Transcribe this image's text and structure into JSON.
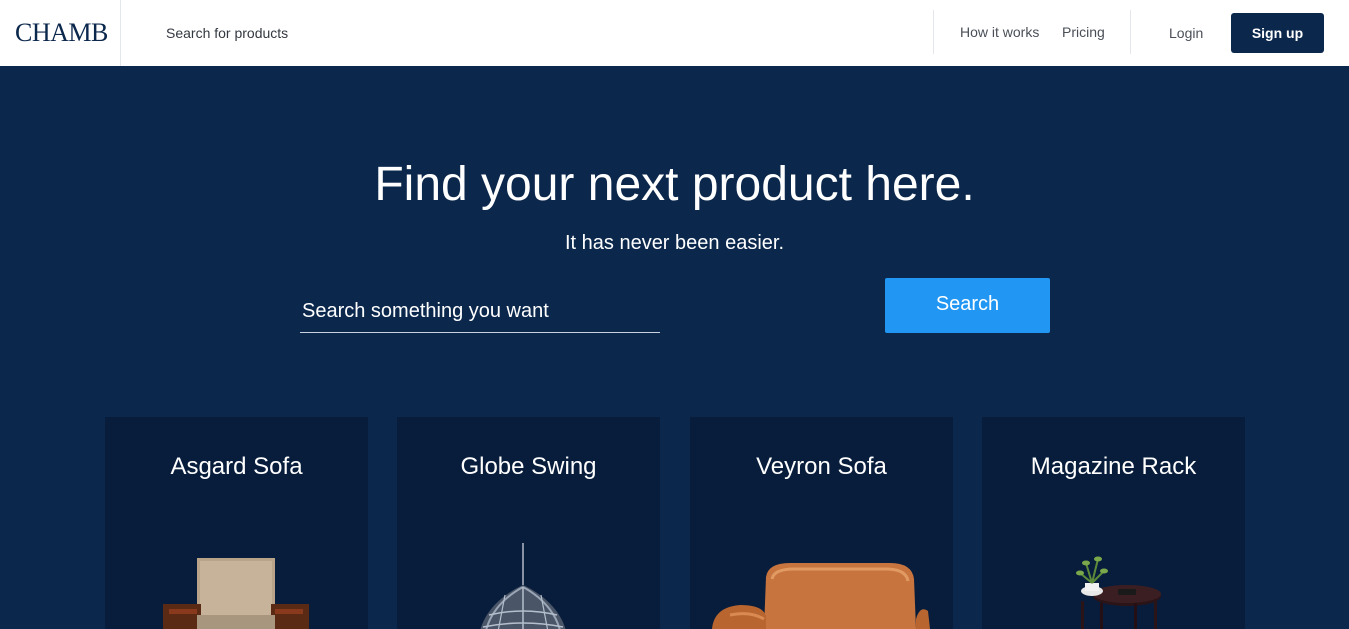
{
  "header": {
    "logo": "CHAMB",
    "search_placeholder": "Search for products",
    "nav": {
      "how_it_works": "How it works",
      "pricing": "Pricing",
      "login": "Login",
      "signup": "Sign up"
    }
  },
  "hero": {
    "title": "Find your next product here.",
    "subtitle": "It has never been easier.",
    "search_placeholder": "Search something you want",
    "search_button": "Search"
  },
  "products": [
    {
      "name": "Asgard Sofa",
      "image": "armchair-image"
    },
    {
      "name": "Globe Swing",
      "image": "hanging-swing-chair-image"
    },
    {
      "name": "Veyron Sofa",
      "image": "leather-armchair-image"
    },
    {
      "name": "Magazine Rack",
      "image": "side-table-with-plant-image"
    }
  ],
  "colors": {
    "navy": "#0b274c",
    "card": "#071d3b",
    "accent": "#2196f3",
    "white": "#ffffff"
  }
}
